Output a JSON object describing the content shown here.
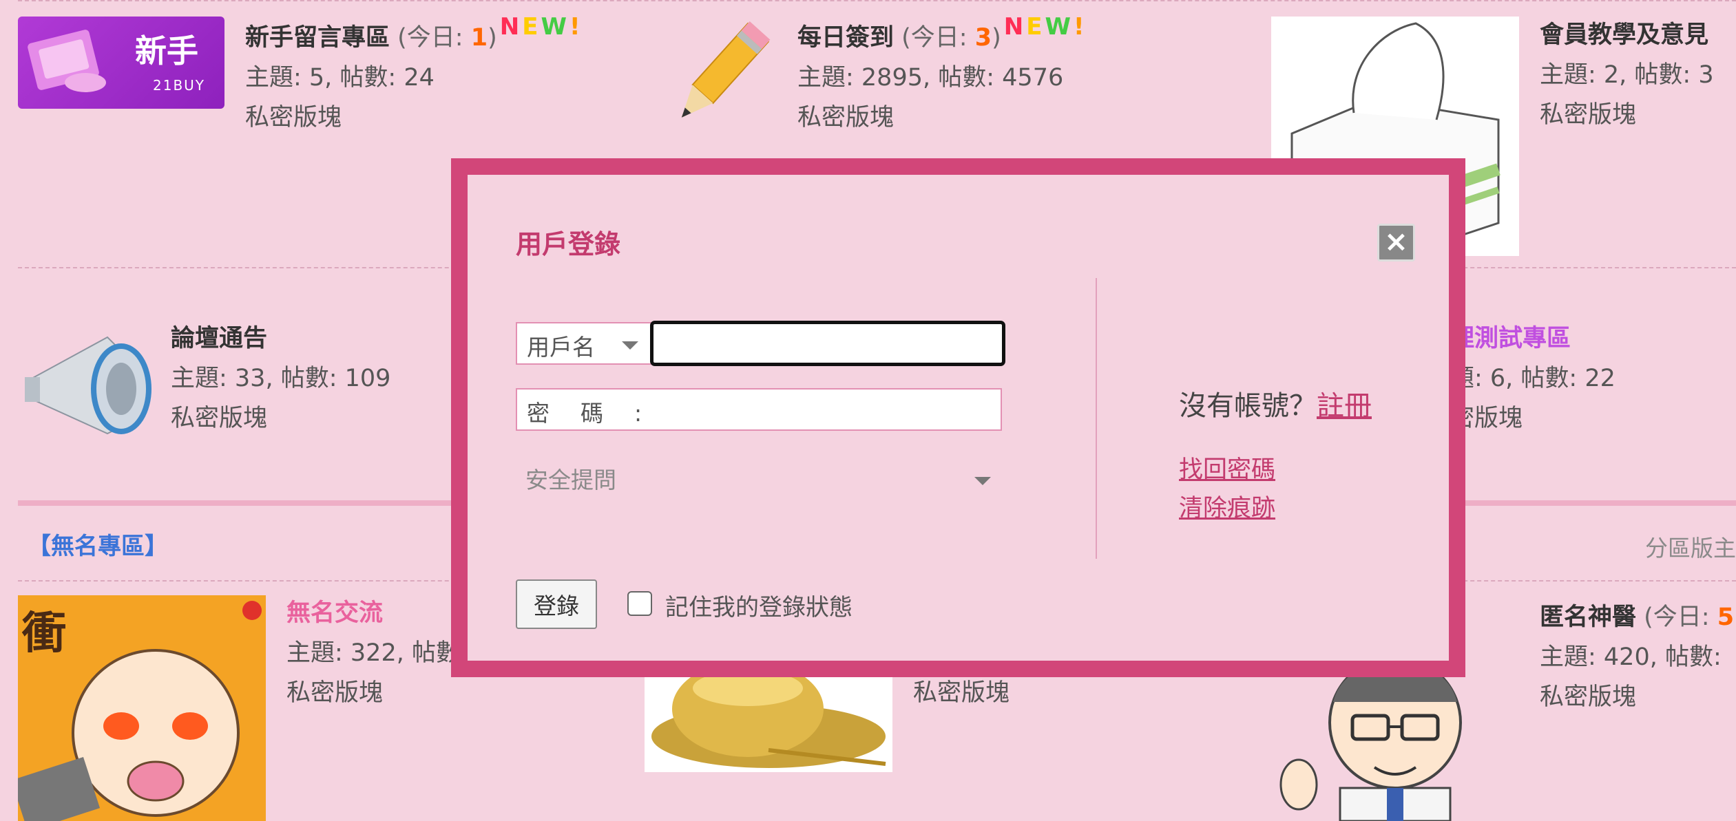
{
  "forums": [
    {
      "name": "新手留言專區",
      "today_label": "(今日: ",
      "today_count": "1",
      "today_close": ")",
      "new_badge": "NEW!",
      "stats": "主題: 5, 帖數: 24",
      "status": "私密版塊",
      "thumb_text": "新手",
      "thumb_sub": "21BUY"
    },
    {
      "name": "每日簽到",
      "today_label": "(今日: ",
      "today_count": "3",
      "today_close": ")",
      "new_badge": "NEW!",
      "stats": "主題: 2895, 帖數: 4576",
      "status": "私密版塊"
    },
    {
      "name": "會員教學及意見",
      "stats": "主題: 2, 帖數: 3",
      "status": "私密版塊"
    },
    {
      "name": "論壇通告",
      "stats": "主題: 33, 帖數: 109",
      "status": "私密版塊"
    },
    {
      "name": "理測試專區",
      "stats": "題: 6, 帖數: 22",
      "status": "密版塊"
    }
  ],
  "section": {
    "title": "【無名專區】",
    "moderator": "分區版主"
  },
  "section_forums": [
    {
      "name": "無名交流",
      "stats": "主題: 322, 帖數",
      "status": "私密版塊",
      "thumb_char": "衝"
    },
    {
      "name": "",
      "stats": "",
      "status": "私密版塊"
    },
    {
      "name": "匿名神醫",
      "today_label": "(今日: ",
      "today_count": "5",
      "stats": "主題: 420, 帖數:",
      "status": "私密版塊"
    }
  ],
  "dialog": {
    "title": "用戶登錄",
    "close_symbol": "×",
    "username_label": "用戶名",
    "username_value": "",
    "password_label": "密　碼　:",
    "security_question": "安全提問",
    "no_account": "沒有帳號？",
    "register": "註冊",
    "find_password": "找回密碼",
    "clear_traces": "清除痕跡",
    "login_button": "登錄",
    "remember_me": "記住我的登錄狀態"
  },
  "colors": {
    "background": "#f5d3e0",
    "dialog_frame": "#d24679",
    "link": "#c33b6e",
    "section_title": "#3b74d8",
    "today_count": "#ff6600"
  }
}
